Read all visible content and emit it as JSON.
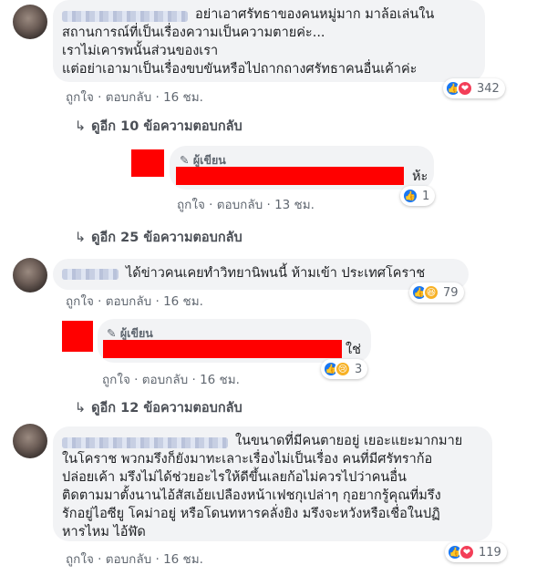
{
  "comments": [
    {
      "text_lines": [
        "อย่าเอาศรัทธาของคนหมู่มาก มาล้อเล่นใน",
        "สถานการณ์ที่เป็นเรื่องความเป็นความตายค่ะ...",
        "เราไม่เคารพนั้นส่วนของเรา",
        "แต่อย่าเอามาเป็นเรื่องขบขันหรือไปถากถางศรัทธาคนอื่นเค้าค่ะ"
      ],
      "like_label": "ถูกใจ",
      "reply_label": "ตอบกลับ",
      "time": "16 ชม.",
      "reaction_count": "342",
      "view_more": "ดูอีก 10 ข้อความตอบกลับ",
      "reply": {
        "author_label": "ผู้เขียน",
        "text_end": "ห้ะ",
        "like_label": "ถูกใจ",
        "reply_label": "ตอบกลับ",
        "time": "13 ชม.",
        "reaction_count": "1"
      },
      "view_more_2": "ดูอีก 25 ข้อความตอบกลับ"
    },
    {
      "text_lines": [
        "ได้ข่าวคนเคยทำวิทยานิพนนี้ ห้ามเข้า ประเทศโคราช"
      ],
      "like_label": "ถูกใจ",
      "reply_label": "ตอบกลับ",
      "time": "16 ชม.",
      "reaction_count": "79",
      "reply": {
        "author_label": "ผู้เขียน",
        "text_end": "ใช่",
        "like_label": "ถูกใจ",
        "reply_label": "ตอบกลับ",
        "time": "16 ชม.",
        "reaction_count": "3"
      },
      "view_more": "ดูอีก 12 ข้อความตอบกลับ"
    },
    {
      "text_lines": [
        "ในขนาดที่มีคนตายอยู่ เยอะแยะมากมาย",
        "ในโคราช พวกมรึงก็ยังมาทะเลาะเรื่องไม่เป็นเรื่อง คนที่มีศรัทราก้อ",
        "ปล่อยเค้า มรึงไม่ได้ช่วยอะไรให้ดีขึ้นเลยก้อไม่ควรไปว่าคนอื่น",
        "ติดตามมาตั้งนานไอ้สัสเอ้ยเปลืองหน้าเฟชกุเปล่าๆ กุอยากรู้คุณที่มรึง",
        "รักอยู่ไอซียู โคม่าอยู่ หรือโดนทหารคลั่งยิง มรึงจะหวังหรือเชื่อในปฏิ",
        "หารไหม ไอ้ฬัด"
      ],
      "like_label": "ถูกใจ",
      "reply_label": "ตอบกลับ",
      "time": "16 ชม.",
      "reaction_count": "119"
    }
  ],
  "colors": {
    "like": "#1877f2",
    "love": "#f33e58",
    "haha": "#f7b125",
    "redact": "#ff0000"
  }
}
